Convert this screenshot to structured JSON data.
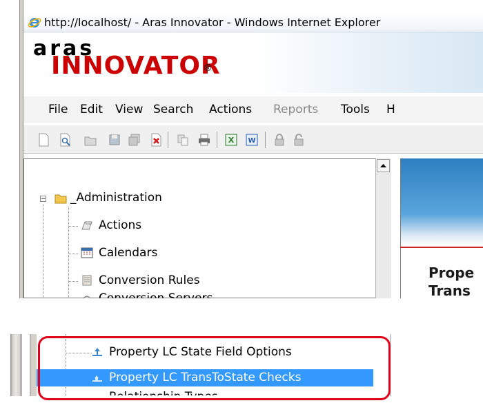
{
  "window": {
    "title": "http://localhost/ - Aras Innovator - Windows Internet Explorer"
  },
  "logo": {
    "top_text": "aras",
    "main_text": "INNOVATOR",
    "reg": "®"
  },
  "menu": [
    "File",
    "Edit",
    "View",
    "Search",
    "Actions",
    "Reports",
    "Tools",
    "H"
  ],
  "tree": {
    "root": "_Administration",
    "items": [
      "Actions",
      "Calendars",
      "Conversion Rules",
      "Conversion Servers"
    ]
  },
  "content": {
    "line1": "Prope",
    "line2": "Trans"
  },
  "bottom_tree": {
    "items": [
      "Property LC State Field Options",
      "Property LC TransToState Checks",
      "Relationship Types"
    ],
    "selected": "Property LC TransToState Checks"
  },
  "colors": {
    "selection": "#3399ff",
    "highlight_box": "#e0001a",
    "logo_red": "#cc0000"
  }
}
